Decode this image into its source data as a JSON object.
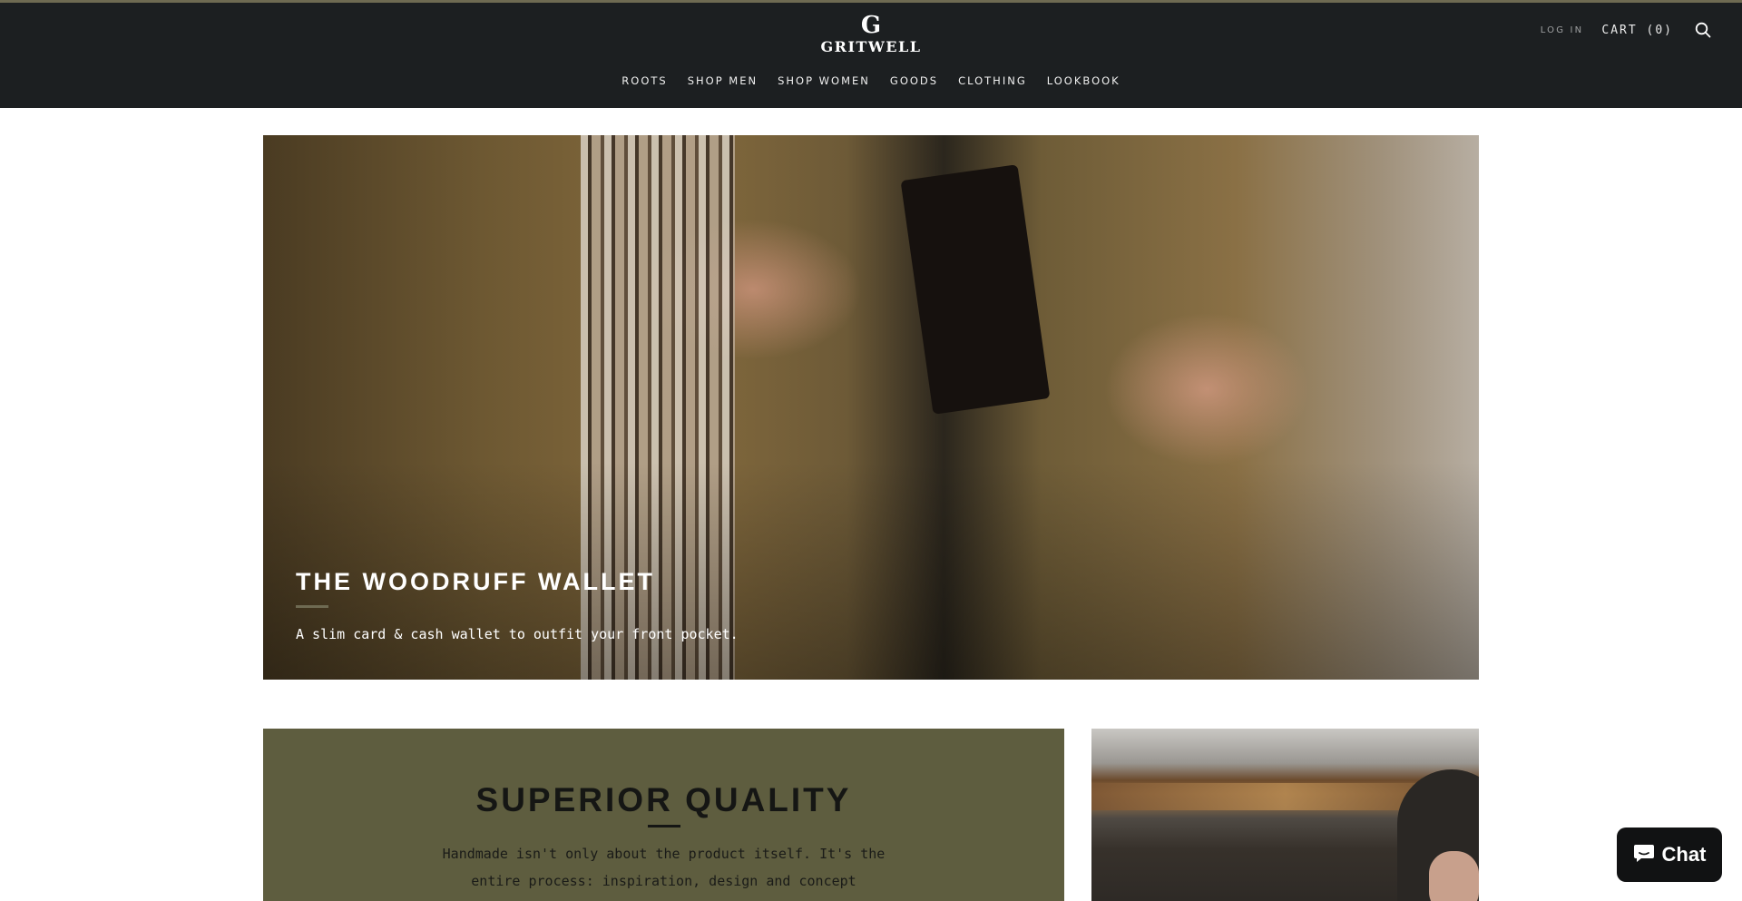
{
  "header": {
    "logo_mark": "G",
    "logo_text": "GRITWELL",
    "login_label": "LOG IN",
    "cart_label": "CART (0)",
    "search_icon": "search-icon",
    "nav": [
      "ROOTS",
      "SHOP MEN",
      "SHOP WOMEN",
      "GOODS",
      "CLOTHING",
      "LOOKBOOK"
    ]
  },
  "hero": {
    "title": "THE WOODRUFF WALLET",
    "subtitle": "A slim card & cash wallet to outfit your front pocket."
  },
  "quality": {
    "title": "SUPERIOR QUALITY",
    "text_line1": "Handmade isn't only about the product itself. It's the",
    "text_line2": "entire process: inspiration, design and concept"
  },
  "chat": {
    "label": "Chat",
    "icon": "chat-bubble-icon"
  },
  "colors": {
    "header_bg": "#1c1f21",
    "accent_olive": "#5e5d3f",
    "chat_bg": "#111213"
  }
}
